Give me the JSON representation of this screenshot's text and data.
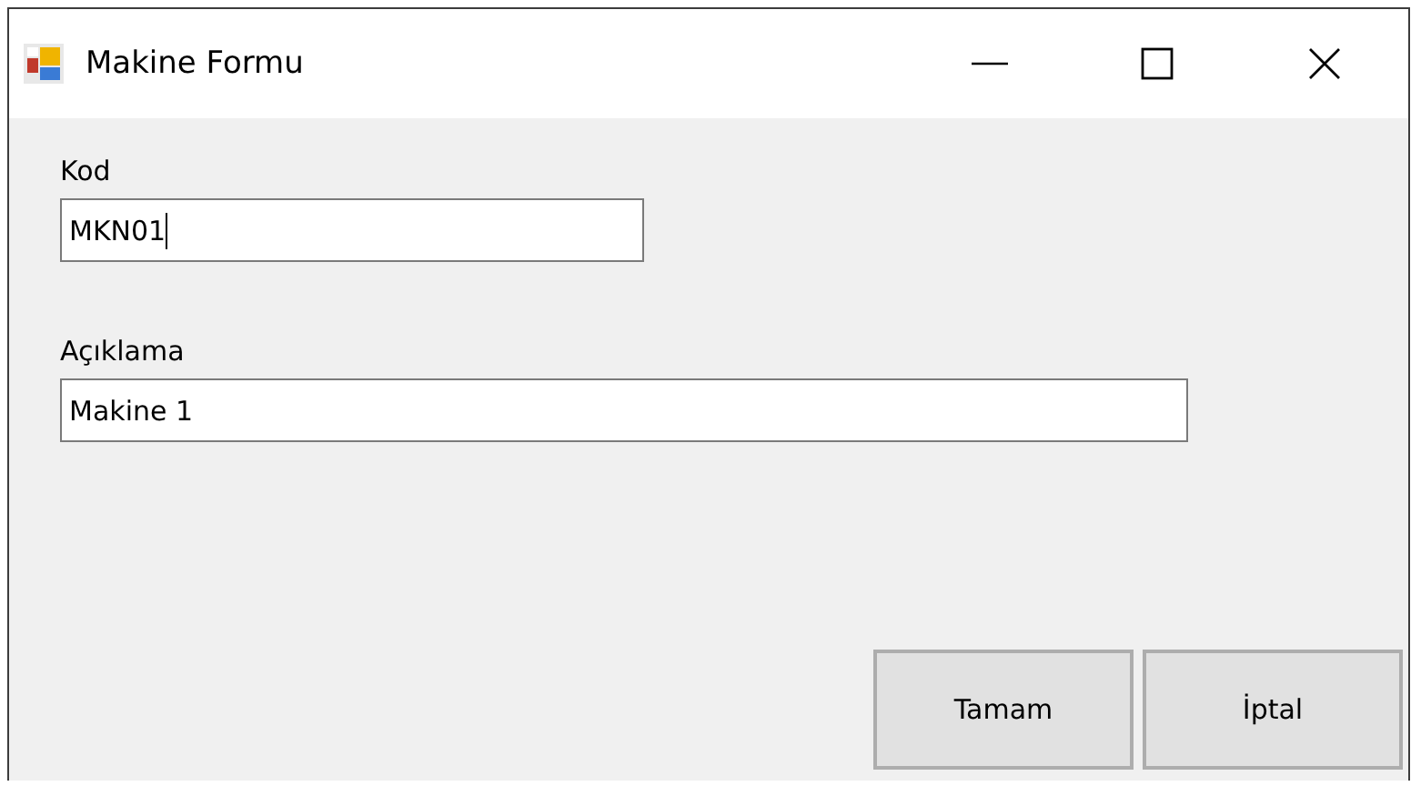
{
  "window": {
    "title": "Makine Formu"
  },
  "fields": [
    {
      "label": "Kod",
      "value": "MKN01",
      "focused": true
    },
    {
      "label": "Açıklama",
      "value": "Makine 1",
      "focused": false
    }
  ],
  "buttons": [
    "Tamam",
    "İptal"
  ]
}
